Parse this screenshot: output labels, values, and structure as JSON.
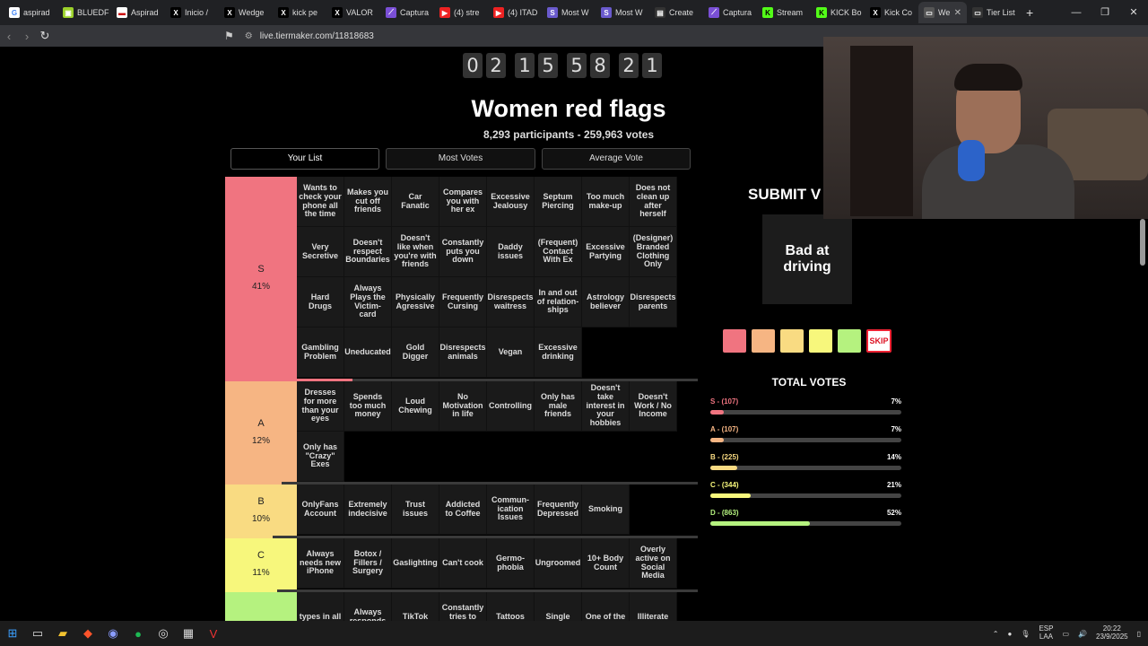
{
  "browser": {
    "tabs": [
      {
        "label": "aspirad",
        "color": "#fff",
        "glyph": "G",
        "fg": "#4285f4"
      },
      {
        "label": "BLUEDF",
        "color": "#9bd12a",
        "glyph": "▣",
        "fg": "#fff"
      },
      {
        "label": "Aspirad",
        "color": "#fff",
        "glyph": "▬",
        "fg": "#c00"
      },
      {
        "label": "Inicio /",
        "color": "#000",
        "glyph": "X",
        "fg": "#fff"
      },
      {
        "label": "Wedge",
        "color": "#000",
        "glyph": "X",
        "fg": "#fff"
      },
      {
        "label": "kick pe",
        "color": "#000",
        "glyph": "X",
        "fg": "#fff"
      },
      {
        "label": "VALOR",
        "color": "#000",
        "glyph": "X",
        "fg": "#fff"
      },
      {
        "label": "Captura",
        "color": "#7a4fd6",
        "glyph": "⟋",
        "fg": "#fff"
      },
      {
        "label": "(4) stre",
        "color": "#e22",
        "glyph": "▶",
        "fg": "#fff"
      },
      {
        "label": "(4) ITAD",
        "color": "#e22",
        "glyph": "▶",
        "fg": "#fff"
      },
      {
        "label": "Most W",
        "color": "#6a5acd",
        "glyph": "S",
        "fg": "#fff"
      },
      {
        "label": "Most W",
        "color": "#6a5acd",
        "glyph": "S",
        "fg": "#fff"
      },
      {
        "label": "Create",
        "color": "#333",
        "glyph": "▤",
        "fg": "#fff"
      },
      {
        "label": "Captura",
        "color": "#7a4fd6",
        "glyph": "⟋",
        "fg": "#fff"
      },
      {
        "label": "Stream",
        "color": "#53fc18",
        "glyph": "K",
        "fg": "#000"
      },
      {
        "label": "KICK Bo",
        "color": "#53fc18",
        "glyph": "K",
        "fg": "#000"
      },
      {
        "label": "Kick Co",
        "color": "#000",
        "glyph": "X",
        "fg": "#fff"
      },
      {
        "label": "We",
        "color": "#555",
        "glyph": "▭",
        "fg": "#fff",
        "active": true
      },
      {
        "label": "Tier List",
        "color": "#333",
        "glyph": "▭",
        "fg": "#fff"
      }
    ],
    "url": "live.tiermaker.com/11818683"
  },
  "page": {
    "counter": [
      "0",
      "2",
      "1",
      "5",
      "5",
      "8",
      "2",
      "1"
    ],
    "title": "Women red flags",
    "subtitle": "8,293 participants - 259,963 votes",
    "tabs": [
      "Your List",
      "Most Votes",
      "Average Vote"
    ]
  },
  "tiers": [
    {
      "label": "S",
      "pct": "41%",
      "color": "#f07480",
      "height": 228,
      "progress": 0.27,
      "pcolor": "#f07480",
      "items": [
        "Wants to check your phone all the time",
        "Makes you cut off friends",
        "Car Fanatic",
        "Compares you with her ex",
        "Excessive Jealousy",
        "Septum Piercing",
        "Too much make-up",
        "Does not clean up after herself",
        "Very Secretive",
        "Doesn't respect Boundaries",
        "Doesn't like when you're with friends",
        "Constantly puts you down",
        "Daddy issues",
        "(Frequent) Contact With Ex",
        "Excessive Partying",
        "(Designer) Branded Clothing Only",
        "Hard Drugs",
        "Always Plays the Victim-card",
        "Physically Agressive",
        "Frequently Cursing",
        "Disrespects waitress",
        "In and out of relation-ships",
        "Astrology believer",
        "Disrespects parents",
        "Gambling Problem",
        "Uneducated",
        "Gold Digger",
        "Disrespects animals",
        "Vegan",
        "Excessive drinking"
      ]
    },
    {
      "label": "A",
      "pct": "12%",
      "color": "#f6b583",
      "height": 115,
      "progress": 0.12,
      "pcolor": "#f6b583",
      "items": [
        "Dresses for more than your eyes",
        "Spends too much money",
        "Loud Chewing",
        "No Motivation in life",
        "Controlling",
        "Only has male friends",
        "Doesn't take interest in your hobbies",
        "Doesn't Work / No Income",
        "Only has \"Crazy\" Exes"
      ]
    },
    {
      "label": "B",
      "pct": "10%",
      "color": "#f9db82",
      "height": 60,
      "progress": 0.1,
      "pcolor": "#f9db82",
      "items": [
        "OnlyFans Account",
        "Extremely indecisive",
        "Trust issues",
        "Addicted to Coffee",
        "Commun-ication Issues",
        "Frequently Depressed",
        "Smoking"
      ]
    },
    {
      "label": "C",
      "pct": "11%",
      "color": "#f7f77c",
      "height": 60,
      "progress": 0.11,
      "pcolor": "#f7f77c",
      "items": [
        "Always needs new iPhone",
        "Botox / Fillers / Surgery",
        "Gaslighting",
        "Can't cook",
        "Germo-phobia",
        "Ungroomed",
        "10+ Body Count",
        "Overly active on Social Media"
      ]
    },
    {
      "label": "",
      "pct": "",
      "color": "#b5f27f",
      "height": 40,
      "progress": 0,
      "pcolor": "#b5f27f",
      "items": [
        "types in all",
        "Always responds",
        "TikTok",
        "Constantly tries to take",
        "Tattoos",
        "Single",
        "One of the",
        "Illiterate"
      ]
    }
  ],
  "vote": {
    "submit": "SUBMIT V",
    "card": "Bad at driving",
    "swatches": [
      "#f07480",
      "#f6b583",
      "#f9db82",
      "#f7f77c",
      "#b5f27f"
    ],
    "skip": "SKIP",
    "totals_title": "TOTAL VOTES",
    "rows": [
      {
        "label": "S - (107)",
        "pct": "7%",
        "frac": 0.07,
        "color": "#f07480"
      },
      {
        "label": "A - (107)",
        "pct": "7%",
        "frac": 0.07,
        "color": "#f6b583"
      },
      {
        "label": "B - (225)",
        "pct": "14%",
        "frac": 0.14,
        "color": "#f9db82"
      },
      {
        "label": "C - (344)",
        "pct": "21%",
        "frac": 0.21,
        "color": "#f7f77c"
      },
      {
        "label": "D - (863)",
        "pct": "52%",
        "frac": 0.52,
        "color": "#b5f27f"
      }
    ]
  },
  "taskbar": {
    "lang": [
      "ESP",
      "LAA"
    ],
    "time": "20:22",
    "date": "23/9/2025"
  }
}
